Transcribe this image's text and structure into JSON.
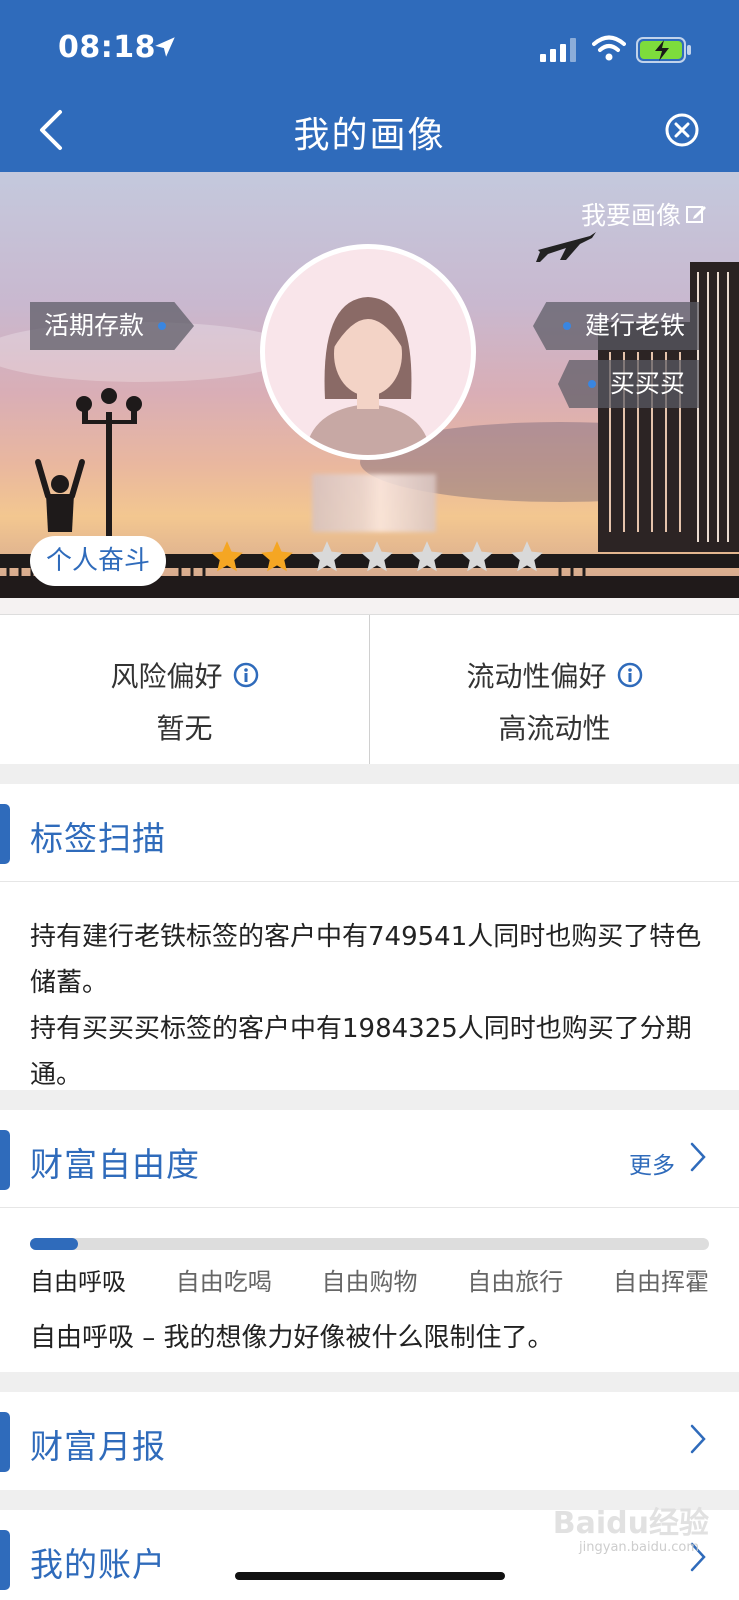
{
  "status_bar": {
    "time": "08:18"
  },
  "nav": {
    "title": "我的画像"
  },
  "hero": {
    "want_portrait": "我要画像",
    "tags_left": [
      "活期存款"
    ],
    "tags_right": [
      "建行老铁",
      "买买买"
    ],
    "persona": "个人奋斗",
    "rating": {
      "filled": 2,
      "total": 7
    },
    "colors": {
      "star_filled": "#f5a623",
      "star_empty": "#d9d9d9"
    }
  },
  "prefs": [
    {
      "label": "风险偏好",
      "value": "暂无"
    },
    {
      "label": "流动性偏好",
      "value": "高流动性"
    }
  ],
  "tag_scan": {
    "title": "标签扫描",
    "lines": [
      "持有建行老铁标签的客户中有749541人同时也购买了特色储蓄。",
      "持有买买买标签的客户中有1984325人同时也购买了分期通。"
    ]
  },
  "wealth_freedom": {
    "title": "财富自由度",
    "more": "更多",
    "progress": 0.07,
    "levels": [
      "自由呼吸",
      "自由吃喝",
      "自由购物",
      "自由旅行",
      "自由挥霍"
    ],
    "current": "自由呼吸 – 我的想像力好像被什么限制住了。"
  },
  "monthly_report": {
    "title": "财富月报"
  },
  "my_account": {
    "title": "我的账户"
  },
  "watermark": {
    "brand": "Baidu经验",
    "url": "jingyan.baidu.com"
  },
  "theme": {
    "primary": "#2f6bbb"
  }
}
